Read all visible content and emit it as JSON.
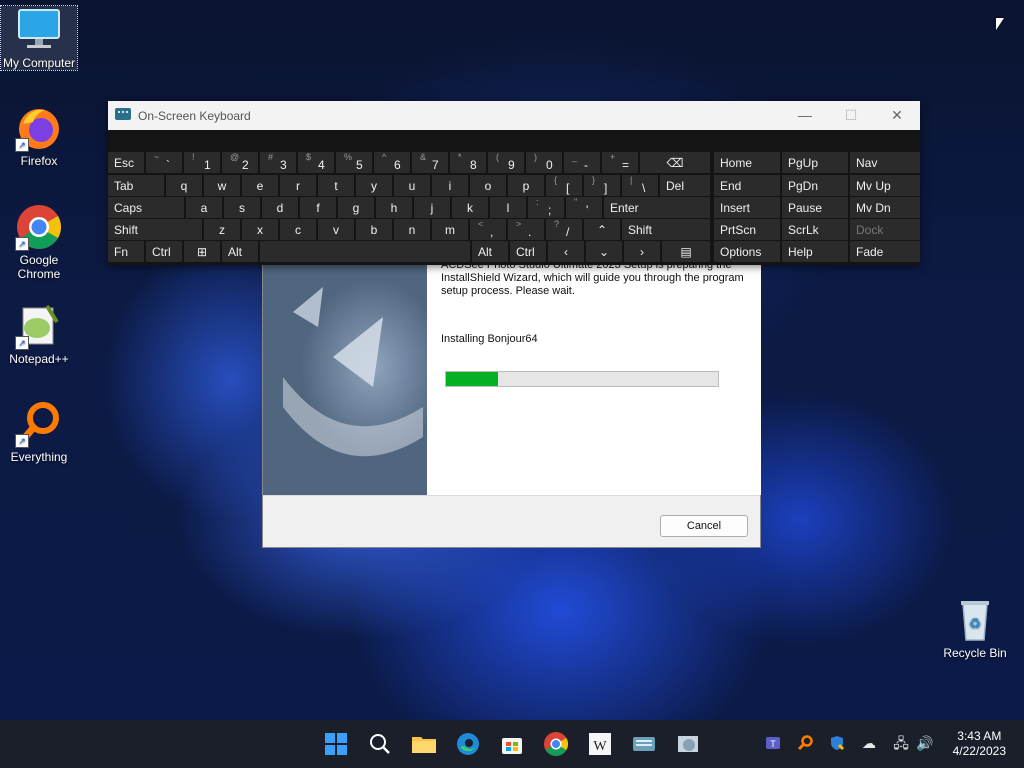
{
  "desktop": {
    "icons": [
      {
        "label": "My Computer"
      },
      {
        "label": "Firefox"
      },
      {
        "label": "Google Chrome"
      },
      {
        "label": "Notepad++"
      },
      {
        "label": "Everything"
      },
      {
        "label": "Recycle Bin"
      }
    ]
  },
  "installer": {
    "message": "ACDSee Photo Studio Ultimate 2023 Setup is preparing the InstallShield Wizard, which will guide you through the program setup process.  Please wait.",
    "status": "Installing Bonjour64",
    "progress_fraction": 0.19,
    "cancel_label": "Cancel",
    "progress_color": "#06b025"
  },
  "osk": {
    "title": "On-Screen Keyboard",
    "keys": {
      "esc": "Esc",
      "tab": "Tab",
      "caps": "Caps",
      "shift_l": "Shift",
      "fn": "Fn",
      "ctrl_l": "Ctrl",
      "alt_l": "Alt",
      "alt_r": "Alt",
      "ctrl_r": "Ctrl",
      "del": "Del",
      "enter": "Enter",
      "shift_r": "Shift",
      "home": "Home",
      "pgup": "PgUp",
      "nav": "Nav",
      "end": "End",
      "pgdn": "PgDn",
      "mvup": "Mv Up",
      "insert": "Insert",
      "pause": "Pause",
      "mvdn": "Mv Dn",
      "prtscn": "PrtScn",
      "scrlk": "ScrLk",
      "dock": "Dock",
      "options": "Options",
      "help": "Help",
      "fade": "Fade"
    },
    "row1": [
      {
        "s": "~",
        "b": "`"
      },
      {
        "s": "!",
        "b": "1"
      },
      {
        "s": "@",
        "b": "2"
      },
      {
        "s": "#",
        "b": "3"
      },
      {
        "s": "$",
        "b": "4"
      },
      {
        "s": "%",
        "b": "5"
      },
      {
        "s": "^",
        "b": "6"
      },
      {
        "s": "&",
        "b": "7"
      },
      {
        "s": "*",
        "b": "8"
      },
      {
        "s": "(",
        "b": "9"
      },
      {
        "s": ")",
        "b": "0"
      },
      {
        "s": "_",
        "b": "-"
      },
      {
        "s": "+",
        "b": "="
      }
    ],
    "row2": [
      "q",
      "w",
      "e",
      "r",
      "t",
      "y",
      "u",
      "i",
      "o",
      "p"
    ],
    "row2_extra": [
      {
        "s": "{",
        "b": "["
      },
      {
        "s": "}",
        "b": "]"
      },
      {
        "s": "|",
        "b": "\\"
      }
    ],
    "row3": [
      "a",
      "s",
      "d",
      "f",
      "g",
      "h",
      "j",
      "k",
      "l"
    ],
    "row3_extra": [
      {
        "s": ":",
        "b": ";"
      },
      {
        "s": "\"",
        "b": "'"
      }
    ],
    "row4": [
      "z",
      "x",
      "c",
      "v",
      "b",
      "n",
      "m"
    ],
    "row4_extra": [
      {
        "s": "<",
        "b": ","
      },
      {
        "s": ">",
        "b": "."
      },
      {
        "s": "?",
        "b": "/"
      }
    ]
  },
  "taskbar": {
    "time": "3:43 AM",
    "date": "4/22/2023"
  }
}
